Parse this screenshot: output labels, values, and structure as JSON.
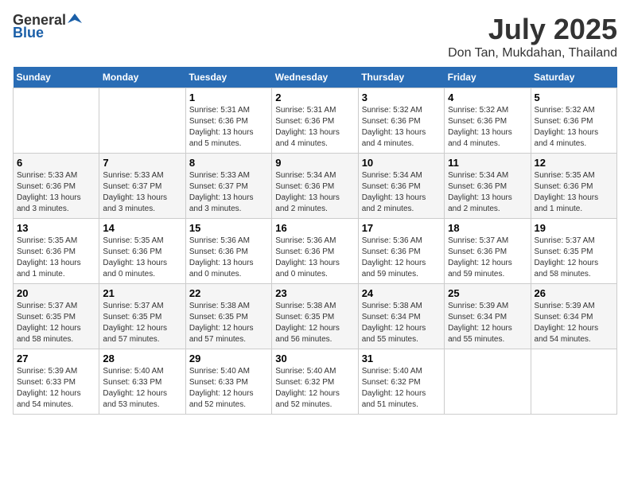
{
  "header": {
    "logo_general": "General",
    "logo_blue": "Blue",
    "month_title": "July 2025",
    "location": "Don Tan, Mukdahan, Thailand"
  },
  "weekdays": [
    "Sunday",
    "Monday",
    "Tuesday",
    "Wednesday",
    "Thursday",
    "Friday",
    "Saturday"
  ],
  "weeks": [
    [
      {
        "day": "",
        "sunrise": "",
        "sunset": "",
        "daylight": ""
      },
      {
        "day": "",
        "sunrise": "",
        "sunset": "",
        "daylight": ""
      },
      {
        "day": "1",
        "sunrise": "Sunrise: 5:31 AM",
        "sunset": "Sunset: 6:36 PM",
        "daylight": "Daylight: 13 hours and 5 minutes."
      },
      {
        "day": "2",
        "sunrise": "Sunrise: 5:31 AM",
        "sunset": "Sunset: 6:36 PM",
        "daylight": "Daylight: 13 hours and 4 minutes."
      },
      {
        "day": "3",
        "sunrise": "Sunrise: 5:32 AM",
        "sunset": "Sunset: 6:36 PM",
        "daylight": "Daylight: 13 hours and 4 minutes."
      },
      {
        "day": "4",
        "sunrise": "Sunrise: 5:32 AM",
        "sunset": "Sunset: 6:36 PM",
        "daylight": "Daylight: 13 hours and 4 minutes."
      },
      {
        "day": "5",
        "sunrise": "Sunrise: 5:32 AM",
        "sunset": "Sunset: 6:36 PM",
        "daylight": "Daylight: 13 hours and 4 minutes."
      }
    ],
    [
      {
        "day": "6",
        "sunrise": "Sunrise: 5:33 AM",
        "sunset": "Sunset: 6:36 PM",
        "daylight": "Daylight: 13 hours and 3 minutes."
      },
      {
        "day": "7",
        "sunrise": "Sunrise: 5:33 AM",
        "sunset": "Sunset: 6:37 PM",
        "daylight": "Daylight: 13 hours and 3 minutes."
      },
      {
        "day": "8",
        "sunrise": "Sunrise: 5:33 AM",
        "sunset": "Sunset: 6:37 PM",
        "daylight": "Daylight: 13 hours and 3 minutes."
      },
      {
        "day": "9",
        "sunrise": "Sunrise: 5:34 AM",
        "sunset": "Sunset: 6:36 PM",
        "daylight": "Daylight: 13 hours and 2 minutes."
      },
      {
        "day": "10",
        "sunrise": "Sunrise: 5:34 AM",
        "sunset": "Sunset: 6:36 PM",
        "daylight": "Daylight: 13 hours and 2 minutes."
      },
      {
        "day": "11",
        "sunrise": "Sunrise: 5:34 AM",
        "sunset": "Sunset: 6:36 PM",
        "daylight": "Daylight: 13 hours and 2 minutes."
      },
      {
        "day": "12",
        "sunrise": "Sunrise: 5:35 AM",
        "sunset": "Sunset: 6:36 PM",
        "daylight": "Daylight: 13 hours and 1 minute."
      }
    ],
    [
      {
        "day": "13",
        "sunrise": "Sunrise: 5:35 AM",
        "sunset": "Sunset: 6:36 PM",
        "daylight": "Daylight: 13 hours and 1 minute."
      },
      {
        "day": "14",
        "sunrise": "Sunrise: 5:35 AM",
        "sunset": "Sunset: 6:36 PM",
        "daylight": "Daylight: 13 hours and 0 minutes."
      },
      {
        "day": "15",
        "sunrise": "Sunrise: 5:36 AM",
        "sunset": "Sunset: 6:36 PM",
        "daylight": "Daylight: 13 hours and 0 minutes."
      },
      {
        "day": "16",
        "sunrise": "Sunrise: 5:36 AM",
        "sunset": "Sunset: 6:36 PM",
        "daylight": "Daylight: 13 hours and 0 minutes."
      },
      {
        "day": "17",
        "sunrise": "Sunrise: 5:36 AM",
        "sunset": "Sunset: 6:36 PM",
        "daylight": "Daylight: 12 hours and 59 minutes."
      },
      {
        "day": "18",
        "sunrise": "Sunrise: 5:37 AM",
        "sunset": "Sunset: 6:36 PM",
        "daylight": "Daylight: 12 hours and 59 minutes."
      },
      {
        "day": "19",
        "sunrise": "Sunrise: 5:37 AM",
        "sunset": "Sunset: 6:35 PM",
        "daylight": "Daylight: 12 hours and 58 minutes."
      }
    ],
    [
      {
        "day": "20",
        "sunrise": "Sunrise: 5:37 AM",
        "sunset": "Sunset: 6:35 PM",
        "daylight": "Daylight: 12 hours and 58 minutes."
      },
      {
        "day": "21",
        "sunrise": "Sunrise: 5:37 AM",
        "sunset": "Sunset: 6:35 PM",
        "daylight": "Daylight: 12 hours and 57 minutes."
      },
      {
        "day": "22",
        "sunrise": "Sunrise: 5:38 AM",
        "sunset": "Sunset: 6:35 PM",
        "daylight": "Daylight: 12 hours and 57 minutes."
      },
      {
        "day": "23",
        "sunrise": "Sunrise: 5:38 AM",
        "sunset": "Sunset: 6:35 PM",
        "daylight": "Daylight: 12 hours and 56 minutes."
      },
      {
        "day": "24",
        "sunrise": "Sunrise: 5:38 AM",
        "sunset": "Sunset: 6:34 PM",
        "daylight": "Daylight: 12 hours and 55 minutes."
      },
      {
        "day": "25",
        "sunrise": "Sunrise: 5:39 AM",
        "sunset": "Sunset: 6:34 PM",
        "daylight": "Daylight: 12 hours and 55 minutes."
      },
      {
        "day": "26",
        "sunrise": "Sunrise: 5:39 AM",
        "sunset": "Sunset: 6:34 PM",
        "daylight": "Daylight: 12 hours and 54 minutes."
      }
    ],
    [
      {
        "day": "27",
        "sunrise": "Sunrise: 5:39 AM",
        "sunset": "Sunset: 6:33 PM",
        "daylight": "Daylight: 12 hours and 54 minutes."
      },
      {
        "day": "28",
        "sunrise": "Sunrise: 5:40 AM",
        "sunset": "Sunset: 6:33 PM",
        "daylight": "Daylight: 12 hours and 53 minutes."
      },
      {
        "day": "29",
        "sunrise": "Sunrise: 5:40 AM",
        "sunset": "Sunset: 6:33 PM",
        "daylight": "Daylight: 12 hours and 52 minutes."
      },
      {
        "day": "30",
        "sunrise": "Sunrise: 5:40 AM",
        "sunset": "Sunset: 6:32 PM",
        "daylight": "Daylight: 12 hours and 52 minutes."
      },
      {
        "day": "31",
        "sunrise": "Sunrise: 5:40 AM",
        "sunset": "Sunset: 6:32 PM",
        "daylight": "Daylight: 12 hours and 51 minutes."
      },
      {
        "day": "",
        "sunrise": "",
        "sunset": "",
        "daylight": ""
      },
      {
        "day": "",
        "sunrise": "",
        "sunset": "",
        "daylight": ""
      }
    ]
  ]
}
